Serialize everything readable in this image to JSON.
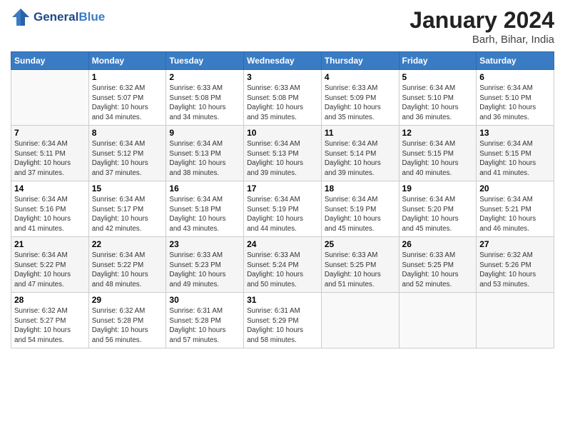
{
  "header": {
    "logo_line1": "General",
    "logo_line2": "Blue",
    "month_title": "January 2024",
    "location": "Barh, Bihar, India"
  },
  "days_of_week": [
    "Sunday",
    "Monday",
    "Tuesday",
    "Wednesday",
    "Thursday",
    "Friday",
    "Saturday"
  ],
  "weeks": [
    [
      {
        "day": "",
        "content": ""
      },
      {
        "day": "1",
        "content": "Sunrise: 6:32 AM\nSunset: 5:07 PM\nDaylight: 10 hours\nand 34 minutes."
      },
      {
        "day": "2",
        "content": "Sunrise: 6:33 AM\nSunset: 5:08 PM\nDaylight: 10 hours\nand 34 minutes."
      },
      {
        "day": "3",
        "content": "Sunrise: 6:33 AM\nSunset: 5:08 PM\nDaylight: 10 hours\nand 35 minutes."
      },
      {
        "day": "4",
        "content": "Sunrise: 6:33 AM\nSunset: 5:09 PM\nDaylight: 10 hours\nand 35 minutes."
      },
      {
        "day": "5",
        "content": "Sunrise: 6:34 AM\nSunset: 5:10 PM\nDaylight: 10 hours\nand 36 minutes."
      },
      {
        "day": "6",
        "content": "Sunrise: 6:34 AM\nSunset: 5:10 PM\nDaylight: 10 hours\nand 36 minutes."
      }
    ],
    [
      {
        "day": "7",
        "content": "Sunrise: 6:34 AM\nSunset: 5:11 PM\nDaylight: 10 hours\nand 37 minutes."
      },
      {
        "day": "8",
        "content": "Sunrise: 6:34 AM\nSunset: 5:12 PM\nDaylight: 10 hours\nand 37 minutes."
      },
      {
        "day": "9",
        "content": "Sunrise: 6:34 AM\nSunset: 5:13 PM\nDaylight: 10 hours\nand 38 minutes."
      },
      {
        "day": "10",
        "content": "Sunrise: 6:34 AM\nSunset: 5:13 PM\nDaylight: 10 hours\nand 39 minutes."
      },
      {
        "day": "11",
        "content": "Sunrise: 6:34 AM\nSunset: 5:14 PM\nDaylight: 10 hours\nand 39 minutes."
      },
      {
        "day": "12",
        "content": "Sunrise: 6:34 AM\nSunset: 5:15 PM\nDaylight: 10 hours\nand 40 minutes."
      },
      {
        "day": "13",
        "content": "Sunrise: 6:34 AM\nSunset: 5:15 PM\nDaylight: 10 hours\nand 41 minutes."
      }
    ],
    [
      {
        "day": "14",
        "content": "Sunrise: 6:34 AM\nSunset: 5:16 PM\nDaylight: 10 hours\nand 41 minutes."
      },
      {
        "day": "15",
        "content": "Sunrise: 6:34 AM\nSunset: 5:17 PM\nDaylight: 10 hours\nand 42 minutes."
      },
      {
        "day": "16",
        "content": "Sunrise: 6:34 AM\nSunset: 5:18 PM\nDaylight: 10 hours\nand 43 minutes."
      },
      {
        "day": "17",
        "content": "Sunrise: 6:34 AM\nSunset: 5:19 PM\nDaylight: 10 hours\nand 44 minutes."
      },
      {
        "day": "18",
        "content": "Sunrise: 6:34 AM\nSunset: 5:19 PM\nDaylight: 10 hours\nand 45 minutes."
      },
      {
        "day": "19",
        "content": "Sunrise: 6:34 AM\nSunset: 5:20 PM\nDaylight: 10 hours\nand 45 minutes."
      },
      {
        "day": "20",
        "content": "Sunrise: 6:34 AM\nSunset: 5:21 PM\nDaylight: 10 hours\nand 46 minutes."
      }
    ],
    [
      {
        "day": "21",
        "content": "Sunrise: 6:34 AM\nSunset: 5:22 PM\nDaylight: 10 hours\nand 47 minutes."
      },
      {
        "day": "22",
        "content": "Sunrise: 6:34 AM\nSunset: 5:22 PM\nDaylight: 10 hours\nand 48 minutes."
      },
      {
        "day": "23",
        "content": "Sunrise: 6:33 AM\nSunset: 5:23 PM\nDaylight: 10 hours\nand 49 minutes."
      },
      {
        "day": "24",
        "content": "Sunrise: 6:33 AM\nSunset: 5:24 PM\nDaylight: 10 hours\nand 50 minutes."
      },
      {
        "day": "25",
        "content": "Sunrise: 6:33 AM\nSunset: 5:25 PM\nDaylight: 10 hours\nand 51 minutes."
      },
      {
        "day": "26",
        "content": "Sunrise: 6:33 AM\nSunset: 5:25 PM\nDaylight: 10 hours\nand 52 minutes."
      },
      {
        "day": "27",
        "content": "Sunrise: 6:32 AM\nSunset: 5:26 PM\nDaylight: 10 hours\nand 53 minutes."
      }
    ],
    [
      {
        "day": "28",
        "content": "Sunrise: 6:32 AM\nSunset: 5:27 PM\nDaylight: 10 hours\nand 54 minutes."
      },
      {
        "day": "29",
        "content": "Sunrise: 6:32 AM\nSunset: 5:28 PM\nDaylight: 10 hours\nand 56 minutes."
      },
      {
        "day": "30",
        "content": "Sunrise: 6:31 AM\nSunset: 5:28 PM\nDaylight: 10 hours\nand 57 minutes."
      },
      {
        "day": "31",
        "content": "Sunrise: 6:31 AM\nSunset: 5:29 PM\nDaylight: 10 hours\nand 58 minutes."
      },
      {
        "day": "",
        "content": ""
      },
      {
        "day": "",
        "content": ""
      },
      {
        "day": "",
        "content": ""
      }
    ]
  ]
}
